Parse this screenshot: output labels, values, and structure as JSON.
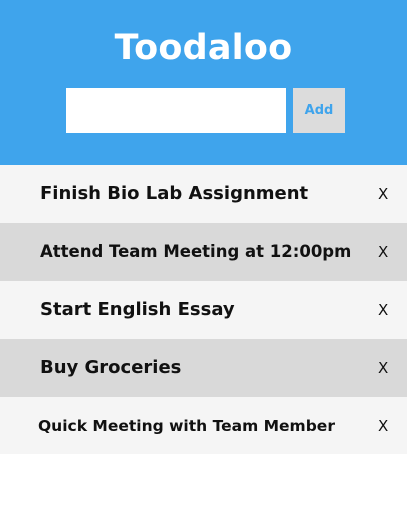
{
  "header": {
    "title": "Toodaloo",
    "input_value": "",
    "input_placeholder": "",
    "add_label": "Add"
  },
  "tasks": [
    {
      "text": "Finish Bio Lab Assignment",
      "delete_label": "X"
    },
    {
      "text": "Attend Team Meeting at 12:00pm",
      "delete_label": "X"
    },
    {
      "text": "Start English Essay",
      "delete_label": "X"
    },
    {
      "text": "Buy Groceries",
      "delete_label": "X"
    },
    {
      "text": "Quick Meeting with Team Member",
      "delete_label": "X"
    }
  ],
  "colors": {
    "header_bg": "#3fa4ec",
    "row_light": "#f5f5f5",
    "row_dark": "#d9d9d9",
    "add_button_bg": "#dcdcdc",
    "add_button_text": "#3fa4ec"
  }
}
